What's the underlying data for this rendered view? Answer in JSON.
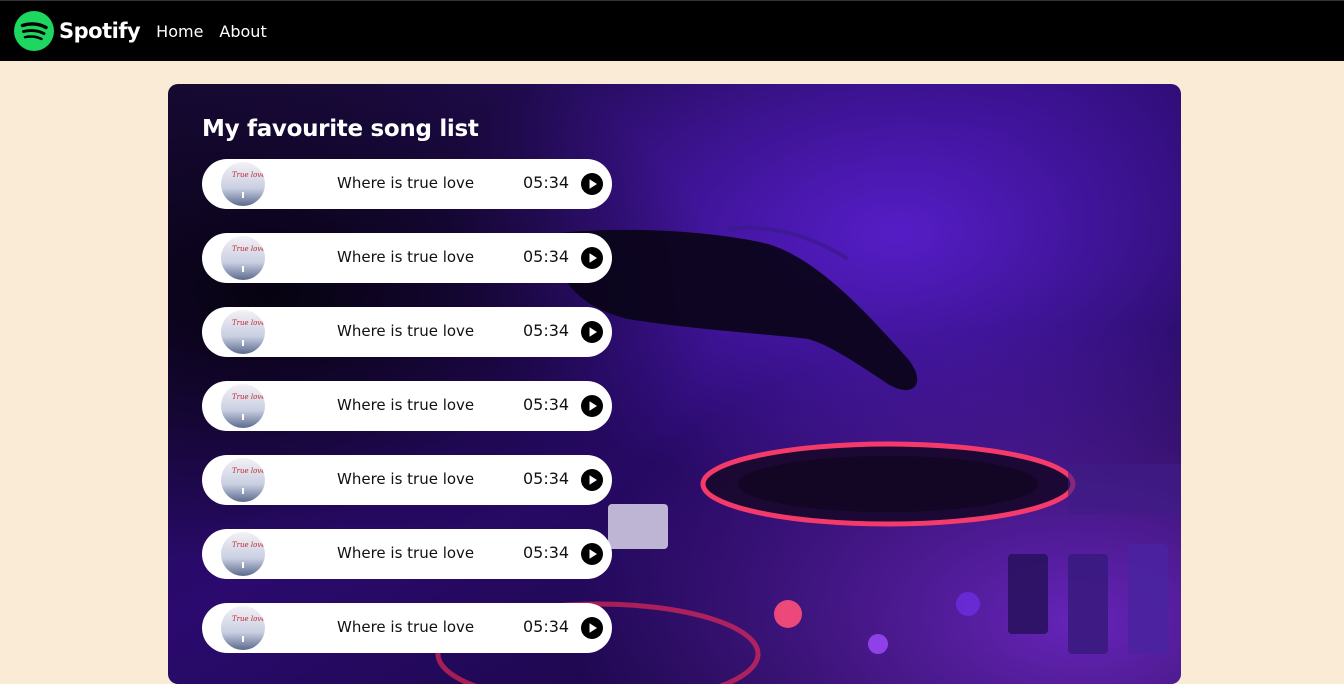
{
  "navbar": {
    "brand": "Spotify",
    "links": [
      {
        "label": "Home"
      },
      {
        "label": "About"
      }
    ]
  },
  "main": {
    "title": "My favourite song list",
    "cover_text": "True love",
    "songs": [
      {
        "name": "Where is true love",
        "duration": "05:34"
      },
      {
        "name": "Where is true love",
        "duration": "05:34"
      },
      {
        "name": "Where is true love",
        "duration": "05:34"
      },
      {
        "name": "Where is true love",
        "duration": "05:34"
      },
      {
        "name": "Where is true love",
        "duration": "05:34"
      },
      {
        "name": "Where is true love",
        "duration": "05:34"
      },
      {
        "name": "Where is true love",
        "duration": "05:34"
      }
    ]
  },
  "colors": {
    "page_background": "#faebd7",
    "navbar_background": "#000000",
    "brand_green": "#1ed760",
    "song_row_background": "#ffffff"
  },
  "icons": {
    "brand": "spotify-logo-icon",
    "play": "play-circle-icon"
  }
}
